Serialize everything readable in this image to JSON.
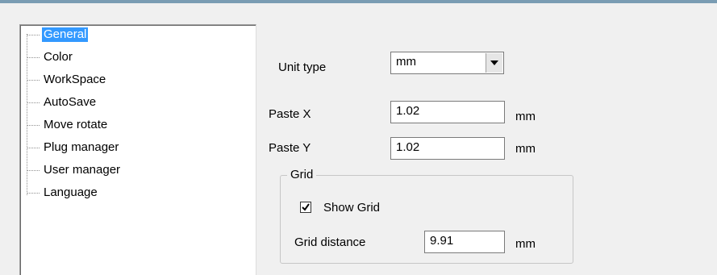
{
  "tree": {
    "items": [
      {
        "label": "General",
        "selected": true
      },
      {
        "label": "Color"
      },
      {
        "label": "WorkSpace"
      },
      {
        "label": "AutoSave"
      },
      {
        "label": "Move rotate"
      },
      {
        "label": "Plug manager"
      },
      {
        "label": "User manager"
      },
      {
        "label": "Language"
      }
    ]
  },
  "form": {
    "unit_type_label": "Unit type",
    "unit_type_value": "mm",
    "paste_x_label": "Paste X",
    "paste_x_value": "1.02",
    "paste_x_unit": "mm",
    "paste_y_label": "Paste Y",
    "paste_y_value": "1.02",
    "paste_y_unit": "mm"
  },
  "grid": {
    "title": "Grid",
    "show_grid_label": "Show Grid",
    "show_grid_checked": true,
    "distance_label": "Grid distance",
    "distance_value": "9.91",
    "distance_unit": "mm"
  },
  "icons": {
    "dropdown": "chevron-down-icon",
    "check": "checkmark-icon"
  }
}
